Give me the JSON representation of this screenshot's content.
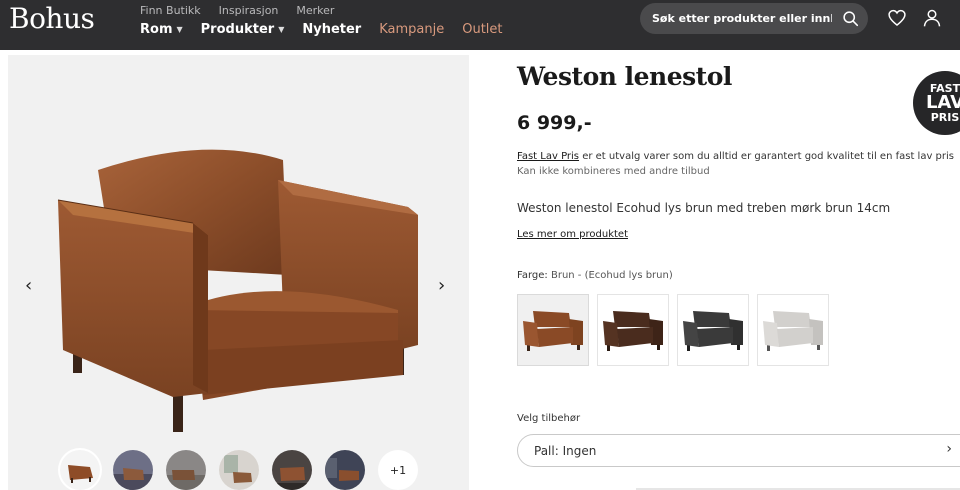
{
  "header": {
    "logo": "Bohus",
    "utility_links": [
      "Finn Butikk",
      "Inspirasjon",
      "Merker"
    ],
    "nav": [
      {
        "label": "Rom",
        "dropdown": true,
        "accent": false
      },
      {
        "label": "Produkter",
        "dropdown": true,
        "accent": false
      },
      {
        "label": "Nyheter",
        "dropdown": false,
        "accent": false
      },
      {
        "label": "Kampanje",
        "dropdown": false,
        "accent": true
      },
      {
        "label": "Outlet",
        "dropdown": false,
        "accent": true
      }
    ],
    "search_placeholder": "Søk etter produkter eller innhold...",
    "icons": [
      "search-icon",
      "heart-icon",
      "user-icon"
    ],
    "colors": {
      "bar": "#2e2e30",
      "accent": "#d99a7e"
    }
  },
  "gallery": {
    "prev_icon": "‹",
    "next_icon": "›",
    "more_label": "+1",
    "thumbnails": [
      "chair-brown",
      "room-scene-1",
      "room-scene-2",
      "room-scene-3",
      "room-scene-4",
      "room-scene-5"
    ]
  },
  "product": {
    "title": "Weston lenestol",
    "price": "6 999,-",
    "badge": {
      "line1": "FAST",
      "line2": "LAV",
      "line3": "PRIS"
    },
    "fastlav_link": "Fast Lav Pris",
    "fastlav_text": " er et utvalg varer som du alltid er garantert god kvalitet til en fast lav pris ",
    "fastlav_muted": "Kan ikke kombineres med andre tilbud",
    "description": "Weston lenestol Ecohud lys brun med treben mørk brun 14cm",
    "read_more": "Les mer om produktet",
    "color_label": "Farge:",
    "color_value": "Brun - (Ecohud lys brun)",
    "swatches": [
      {
        "name": "Brun",
        "color": "#8a4a26",
        "active": true
      },
      {
        "name": "Mørk brun",
        "color": "#4a2c1e",
        "active": false
      },
      {
        "name": "Antrasitt",
        "color": "#3a3a3a",
        "active": false
      },
      {
        "name": "Lys grå",
        "color": "#d2d0cd",
        "active": false
      }
    ],
    "accessories_label": "Velg tilbehør",
    "accessories_value": "Pall: Ingen"
  }
}
